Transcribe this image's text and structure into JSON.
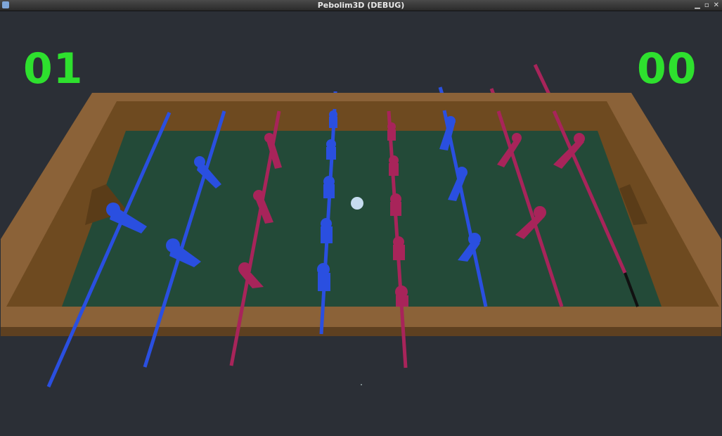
{
  "window": {
    "title": "Pebolim3D (DEBUG)",
    "icon": "app-icon",
    "buttons": {
      "minimize": "▁",
      "maximize": "▫",
      "close": "✕"
    }
  },
  "scoreboard": {
    "left_score": "01",
    "right_score": "00",
    "score_color": "#2ee02e"
  },
  "colors": {
    "blue_team": "#2a4fe0",
    "red_team": "#a8245a",
    "field": "#234a38",
    "frame": "#8b6238",
    "ball": "#c6dcef",
    "background": "#2b2f36"
  }
}
